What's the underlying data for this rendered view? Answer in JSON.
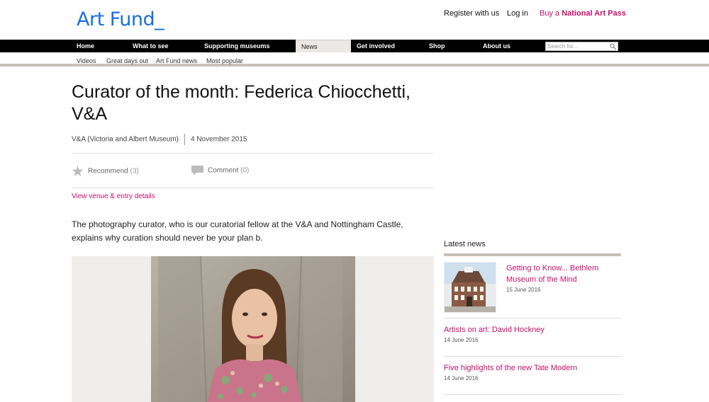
{
  "header": {
    "logo": "Art Fund_",
    "links": {
      "register": "Register with us",
      "login": "Log in",
      "buy_prefix": "Buy a ",
      "buy_bold": "National Art Pass"
    }
  },
  "nav": {
    "items": [
      "Home",
      "What to see",
      "Supporting museums",
      "News",
      "Get involved",
      "Shop",
      "About us"
    ],
    "active": "News",
    "search_placeholder": "Search for..."
  },
  "subnav": {
    "items": [
      "Videos",
      "Great days out",
      "Art Fund news",
      "Most popular"
    ]
  },
  "article": {
    "title": "Curator of the month: Federica Chiocchetti, V&A",
    "venue": "V&A (Victoria and Albert Museum)",
    "date": "4 November 2015",
    "recommend_label": "Recommend",
    "recommend_count": "(3)",
    "comment_label": "Comment",
    "comment_count": "(0)",
    "venue_link": "View venue & entry details",
    "intro": "The photography curator, who is our curatorial fellow at the V&A and Nottingham Castle, explains why curation should never be your plan b."
  },
  "sidebar": {
    "heading": "Latest news",
    "items": [
      {
        "title": "Getting to Know... Bethlem Museum of the Mind",
        "date": "15 June 2016"
      },
      {
        "title": "Artists on art: David Hockney",
        "date": "14 June 2016"
      },
      {
        "title": "Five highlights of the new Tate Modern",
        "date": "14 June 2016"
      }
    ]
  },
  "colors": {
    "brand_blue": "#1a6fe0",
    "accent_magenta": "#c7106b",
    "nav_black": "#000000",
    "rule_taupe": "#c8bfb8"
  }
}
